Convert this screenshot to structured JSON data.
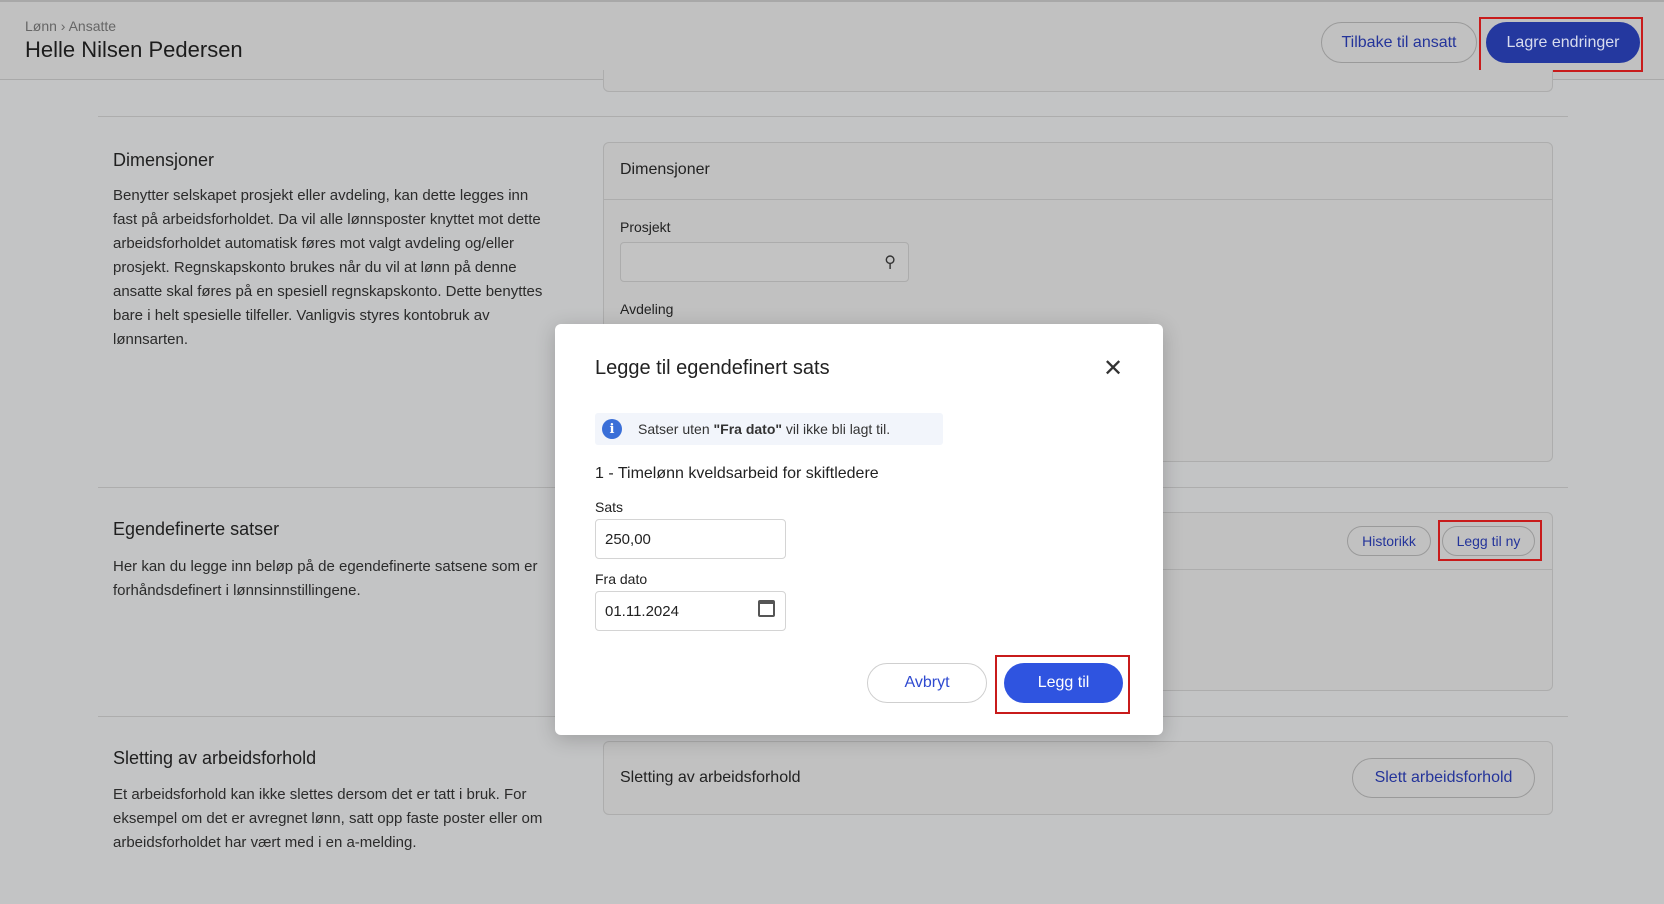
{
  "header": {
    "breadcrumb": "Lønn › Ansatte",
    "title": "Helle Nilsen Pedersen",
    "back_label": "Tilbake til ansatt",
    "save_label": "Lagre endringer"
  },
  "sections": {
    "dimensions": {
      "heading": "Dimensjoner",
      "text": "Benytter selskapet prosjekt eller avdeling, kan dette legges inn fast på arbeidsforholdet. Da vil alle lønnsposter knyttet mot dette arbeidsforholdet automatisk føres mot valgt avdeling og/eller prosjekt. Regnskapskonto brukes når du vil at lønn på denne ansatte skal føres på en spesiell regnskapskonto. Dette benyttes bare i helt spesielle tilfeller. Vanligvis styres kontobruk av lønnsarten.",
      "card_title": "Dimensjoner",
      "project_label": "Prosjekt",
      "project_value": "",
      "department_label": "Avdeling"
    },
    "custom_rates": {
      "heading": "Egendefinerte satser",
      "text": "Her kan du legge inn beløp på de egendefinerte satsene som er forhåndsdefinert i lønnsinnstillingene.",
      "history_label": "Historikk",
      "add_new_label": "Legg til ny"
    },
    "deletion": {
      "heading": "Sletting av arbeidsforhold",
      "text": "Et arbeidsforhold kan ikke slettes dersom det er tatt i bruk. For eksempel om det er avregnet lønn, satt opp faste poster eller om arbeidsforholdet har vært med i en a-melding.",
      "card_title": "Sletting av arbeidsforhold",
      "delete_label": "Slett arbeidsforhold"
    }
  },
  "modal": {
    "title": "Legge til egendefinert sats",
    "info_prefix": "Satser uten ",
    "info_bold": "\"Fra dato\"",
    "info_suffix": " vil ikke bli lagt til.",
    "subtitle": "1 - Timelønn kveldsarbeid for skiftledere",
    "rate_label": "Sats",
    "rate_value": "250,00",
    "date_label": "Fra dato",
    "date_value": "01.11.2024",
    "cancel_label": "Avbryt",
    "add_label": "Legg til"
  },
  "colors": {
    "primary": "#2f54e0",
    "highlight": "#c81b1b"
  }
}
